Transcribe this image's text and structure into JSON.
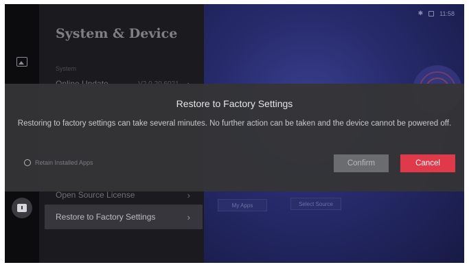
{
  "status_bar": {
    "time": "11:58"
  },
  "settings_panel": {
    "title": "System & Device",
    "section_label": "System",
    "items": [
      {
        "label": "Online Update",
        "value": "V2.0.20.6021"
      },
      {
        "label": "Open Source License",
        "value": ""
      },
      {
        "label": "Restore to Factory Settings",
        "value": ""
      }
    ]
  },
  "home": {
    "buttons": [
      "My Apps",
      "Select Source"
    ]
  },
  "dialog": {
    "title": "Restore to Factory Settings",
    "message": "Restoring to factory settings can take several minutes. No further action can be taken and the device cannot be powered off.",
    "retain_option": "Retain Installed Apps",
    "confirm_label": "Confirm",
    "cancel_label": "Cancel"
  },
  "colors": {
    "cancel_accent": "#e0394a",
    "confirm_bg": "#6b6c70",
    "home_blue": "#262a6a"
  },
  "icons": {
    "rail": [
      "gallery-icon",
      "device-settings-icon"
    ],
    "status": [
      "bluetooth-icon",
      "display-icon"
    ]
  }
}
